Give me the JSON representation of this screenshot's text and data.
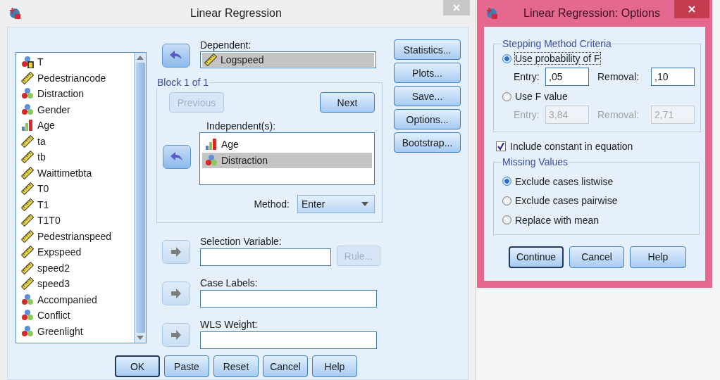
{
  "main_window": {
    "title": "Linear Regression"
  },
  "variables": [
    {
      "name": "T",
      "kind": "nominal_string"
    },
    {
      "name": "Pedestriancode",
      "kind": "scale"
    },
    {
      "name": "Distraction",
      "kind": "nominal"
    },
    {
      "name": "Gender",
      "kind": "nominal"
    },
    {
      "name": "Age",
      "kind": "ordinal"
    },
    {
      "name": "ta",
      "kind": "scale"
    },
    {
      "name": "tb",
      "kind": "scale"
    },
    {
      "name": "Waittimetbta",
      "kind": "scale"
    },
    {
      "name": "T0",
      "kind": "scale"
    },
    {
      "name": "T1",
      "kind": "scale"
    },
    {
      "name": "T1T0",
      "kind": "scale"
    },
    {
      "name": "Pedestrianspeed",
      "kind": "scale"
    },
    {
      "name": "Expspeed",
      "kind": "scale"
    },
    {
      "name": "speed2",
      "kind": "scale"
    },
    {
      "name": "speed3",
      "kind": "scale"
    },
    {
      "name": "Accompanied",
      "kind": "nominal"
    },
    {
      "name": "Conflict",
      "kind": "nominal"
    },
    {
      "name": "Greenlight",
      "kind": "nominal"
    }
  ],
  "dependent": {
    "label": "Dependent:",
    "arrow": {
      "kind": "left",
      "disabled": false
    },
    "variables": [
      {
        "name": "Logspeed",
        "kind": "scale",
        "selected": true
      }
    ]
  },
  "block": {
    "title": "Block 1 of 1",
    "previous": {
      "label": "Previous",
      "disabled": true
    },
    "next": {
      "label": "Next",
      "disabled": false
    },
    "independents_label": "Independent(s):",
    "arrow": {
      "kind": "left",
      "disabled": false
    },
    "independents": [
      {
        "name": "Age",
        "kind": "ordinal",
        "selected": false
      },
      {
        "name": "Distraction",
        "kind": "nominal",
        "selected": true
      }
    ],
    "method_label": "Method:",
    "method": "Enter"
  },
  "selection_variable": {
    "label": "Selection Variable:",
    "arrow": {
      "kind": "right",
      "disabled": true
    },
    "rule": {
      "label": "Rule...",
      "disabled": true
    }
  },
  "case_labels": {
    "label": "Case Labels:",
    "arrow": {
      "kind": "right",
      "disabled": true
    }
  },
  "wls_weight": {
    "label": "WLS Weight:",
    "arrow": {
      "kind": "right",
      "disabled": true
    }
  },
  "side_buttons": [
    "Statistics...",
    "Plots...",
    "Save...",
    "Options...",
    "Bootstrap..."
  ],
  "bottom_buttons": [
    {
      "label": "OK",
      "default": true
    },
    {
      "label": "Paste",
      "default": false
    },
    {
      "label": "Reset",
      "default": false
    },
    {
      "label": "Cancel",
      "default": false
    },
    {
      "label": "Help",
      "default": false
    }
  ],
  "options_dialog": {
    "title": "Linear Regression: Options",
    "stepping": {
      "title": "Stepping Method Criteria",
      "choices": [
        {
          "label": "Use probability of F",
          "selected": true,
          "entry_label": "Entry:",
          "entry": ",05",
          "removal_label": "Removal:",
          "removal": ",10"
        },
        {
          "label": "Use F value",
          "selected": false,
          "entry_label": "Entry:",
          "entry": "3,84",
          "removal_label": "Removal:",
          "removal": "2,71"
        }
      ]
    },
    "include_constant": {
      "label": "Include constant in equation",
      "checked": true
    },
    "missing": {
      "title": "Missing Values",
      "choices": [
        {
          "label": "Exclude cases listwise",
          "selected": true
        },
        {
          "label": "Exclude cases pairwise",
          "selected": false
        },
        {
          "label": "Replace with mean",
          "selected": false
        }
      ]
    },
    "buttons": [
      {
        "label": "Continue",
        "default": true
      },
      {
        "label": "Cancel",
        "default": false
      },
      {
        "label": "Help",
        "default": false
      }
    ]
  }
}
